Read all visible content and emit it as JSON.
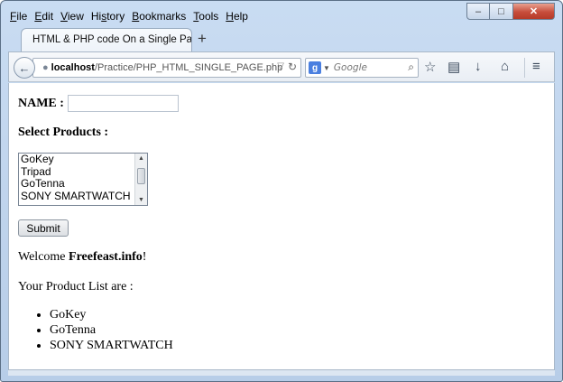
{
  "menubar": [
    {
      "pre": "",
      "u": "F",
      "post": "ile"
    },
    {
      "pre": "",
      "u": "E",
      "post": "dit"
    },
    {
      "pre": "",
      "u": "V",
      "post": "iew"
    },
    {
      "pre": "Hi",
      "u": "s",
      "post": "tory"
    },
    {
      "pre": "",
      "u": "B",
      "post": "ookmarks"
    },
    {
      "pre": "",
      "u": "T",
      "post": "ools"
    },
    {
      "pre": "",
      "u": "H",
      "post": "elp"
    }
  ],
  "tab": {
    "title": "HTML & PHP code On a Single Pa..."
  },
  "url": {
    "host": "localhost",
    "path": "/Practice/PHP_HTML_SINGLE_PAGE.php"
  },
  "search": {
    "placeholder": "Google",
    "engine_letter": "g"
  },
  "form": {
    "name_label": "NAME :",
    "name_value": "",
    "select_label": "Select Products :",
    "options": [
      "GoKey",
      "Tripad",
      "GoTenna",
      "SONY SMARTWATCH"
    ],
    "submit_label": "Submit"
  },
  "result": {
    "welcome_prefix": "Welcome ",
    "welcome_name": "Freefeast.info",
    "welcome_suffix": "!",
    "list_label": "Your Product List are :",
    "items": [
      "GoKey",
      "GoTenna",
      "SONY SMARTWATCH"
    ]
  }
}
